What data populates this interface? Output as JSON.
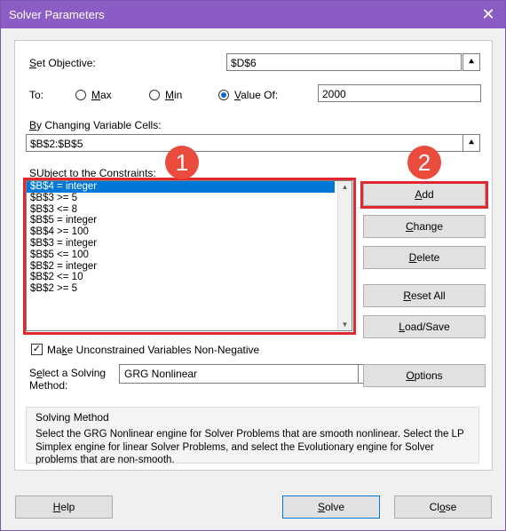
{
  "window": {
    "title": "Solver Parameters",
    "close_glyph": "✕"
  },
  "objective": {
    "label_u": "S",
    "label_rest": "et Objective:",
    "value": "$D$6"
  },
  "to": {
    "label": "To:",
    "max": {
      "u": "M",
      "rest": "ax"
    },
    "min": {
      "u": "M",
      "rest": "in"
    },
    "value_of": {
      "u": "V",
      "rest": "alue Of:"
    },
    "selected": "value_of",
    "value": "2000"
  },
  "changing": {
    "label_u": "B",
    "label_rest": "y Changing Variable Cells:",
    "value": "$B$2:$B$5"
  },
  "constraints": {
    "label_u": "U",
    "label_rest": "bject to the Constraints:",
    "label_pre": "S",
    "items": [
      "$B$4 = integer",
      "$B$3 >= 5",
      "$B$3 <= 8",
      "$B$5 = integer",
      "$B$4 >= 100",
      "$B$3 = integer",
      "$B$5 <= 100",
      "$B$2 = integer",
      "$B$2 <= 10",
      "$B$2 >= 5"
    ]
  },
  "side_buttons": {
    "add": {
      "u": "A",
      "rest": "dd"
    },
    "change": {
      "u": "C",
      "rest": "hange"
    },
    "delete": {
      "u": "D",
      "rest": "elete"
    },
    "reset": {
      "u": "R",
      "rest": "eset All"
    },
    "load": {
      "u": "L",
      "rest": "oad/Save"
    }
  },
  "badges": {
    "one": "1",
    "two": "2"
  },
  "nonneg": {
    "u": "k",
    "pre": "Ma",
    "rest": "e Unconstrained Variables Non-Negative",
    "checked": true
  },
  "method": {
    "label_line1_pre": "S",
    "label_line1_u": "e",
    "label_line1_rest": "lect a Solving",
    "label_line2": "Method:",
    "value": "GRG Nonlinear",
    "options": {
      "pre": "",
      "u": "O",
      "rest": "ptions"
    }
  },
  "solving_method": {
    "title": "Solving Method",
    "text": "Select the GRG Nonlinear engine for Solver Problems that are smooth nonlinear. Select the LP Simplex engine for linear Solver Problems, and select the Evolutionary engine for Solver problems that are non-smooth."
  },
  "footer": {
    "help": {
      "u": "H",
      "rest": "elp"
    },
    "solve": {
      "u": "S",
      "rest": "olve"
    },
    "close": {
      "pre": "Cl",
      "u": "o",
      "rest": "se"
    }
  },
  "colors": {
    "titlebar": "#8a5cc4",
    "highlight": "#e0282e",
    "badge": "#e94b3c",
    "selection": "#0078d7"
  }
}
